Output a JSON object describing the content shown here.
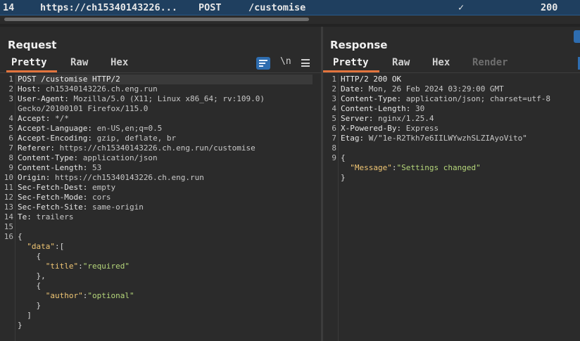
{
  "history_row": {
    "number": "14",
    "host": "https://ch15340143226...",
    "method": "POST",
    "path": "/customise",
    "checkmark": "✓",
    "status": "200"
  },
  "request": {
    "title": "Request",
    "tabs": [
      "Pretty",
      "Raw",
      "Hex"
    ],
    "active_tab": "Pretty",
    "tools": {
      "wrap_icon": "wrap-lines-icon",
      "newline_label": "\\n",
      "menu_icon": "hamburger-menu-icon"
    },
    "lines": [
      {
        "n": "1",
        "parts": [
          {
            "t": "POST /customise HTTP/2",
            "c": "req-line"
          }
        ]
      },
      {
        "n": "2",
        "parts": [
          {
            "t": "Host: ",
            "c": "hdr-name"
          },
          {
            "t": "ch15340143226.ch.eng.run",
            "c": "hdr-val"
          }
        ]
      },
      {
        "n": "3",
        "parts": [
          {
            "t": "User-Agent: ",
            "c": "hdr-name"
          },
          {
            "t": "Mozilla/5.0 (X11; Linux x86_64; rv:109.0)",
            "c": "hdr-val"
          }
        ]
      },
      {
        "n": "",
        "parts": [
          {
            "t": "Gecko/20100101 Firefox/115.0",
            "c": "hdr-val"
          }
        ]
      },
      {
        "n": "4",
        "parts": [
          {
            "t": "Accept: ",
            "c": "hdr-name"
          },
          {
            "t": "*/*",
            "c": "hdr-val"
          }
        ]
      },
      {
        "n": "5",
        "parts": [
          {
            "t": "Accept-Language: ",
            "c": "hdr-name"
          },
          {
            "t": "en-US,en;q=0.5",
            "c": "hdr-val"
          }
        ]
      },
      {
        "n": "6",
        "parts": [
          {
            "t": "Accept-Encoding: ",
            "c": "hdr-name"
          },
          {
            "t": "gzip, deflate, br",
            "c": "hdr-val"
          }
        ]
      },
      {
        "n": "7",
        "parts": [
          {
            "t": "Referer: ",
            "c": "hdr-name"
          },
          {
            "t": "https://ch15340143226.ch.eng.run/customise",
            "c": "hdr-val"
          }
        ]
      },
      {
        "n": "8",
        "parts": [
          {
            "t": "Content-Type: ",
            "c": "hdr-name"
          },
          {
            "t": "application/json",
            "c": "hdr-val"
          }
        ]
      },
      {
        "n": "9",
        "parts": [
          {
            "t": "Content-Length: ",
            "c": "hdr-name"
          },
          {
            "t": "53",
            "c": "hdr-val"
          }
        ]
      },
      {
        "n": "10",
        "parts": [
          {
            "t": "Origin: ",
            "c": "hdr-name"
          },
          {
            "t": "https://ch15340143226.ch.eng.run",
            "c": "hdr-val"
          }
        ]
      },
      {
        "n": "11",
        "parts": [
          {
            "t": "Sec-Fetch-Dest: ",
            "c": "hdr-name"
          },
          {
            "t": "empty",
            "c": "hdr-val"
          }
        ]
      },
      {
        "n": "12",
        "parts": [
          {
            "t": "Sec-Fetch-Mode: ",
            "c": "hdr-name"
          },
          {
            "t": "cors",
            "c": "hdr-val"
          }
        ]
      },
      {
        "n": "13",
        "parts": [
          {
            "t": "Sec-Fetch-Site: ",
            "c": "hdr-name"
          },
          {
            "t": "same-origin",
            "c": "hdr-val"
          }
        ]
      },
      {
        "n": "14",
        "parts": [
          {
            "t": "Te: ",
            "c": "hdr-name"
          },
          {
            "t": "trailers",
            "c": "hdr-val"
          }
        ]
      },
      {
        "n": "15",
        "parts": []
      },
      {
        "n": "16",
        "parts": [
          {
            "t": "{",
            "c": "json-punct"
          }
        ]
      },
      {
        "n": "",
        "parts": [
          {
            "t": "  ",
            "c": "json-punct"
          },
          {
            "t": "\"data\"",
            "c": "json-key"
          },
          {
            "t": ":[",
            "c": "json-punct"
          }
        ]
      },
      {
        "n": "",
        "parts": [
          {
            "t": "    {",
            "c": "json-punct"
          }
        ]
      },
      {
        "n": "",
        "parts": [
          {
            "t": "      ",
            "c": "json-punct"
          },
          {
            "t": "\"title\"",
            "c": "json-key"
          },
          {
            "t": ":",
            "c": "json-punct"
          },
          {
            "t": "\"required\"",
            "c": "json-str"
          }
        ]
      },
      {
        "n": "",
        "parts": [
          {
            "t": "    },",
            "c": "json-punct"
          }
        ]
      },
      {
        "n": "",
        "parts": [
          {
            "t": "    {",
            "c": "json-punct"
          }
        ]
      },
      {
        "n": "",
        "parts": [
          {
            "t": "      ",
            "c": "json-punct"
          },
          {
            "t": "\"author\"",
            "c": "json-key"
          },
          {
            "t": ":",
            "c": "json-punct"
          },
          {
            "t": "\"optional\"",
            "c": "json-str"
          }
        ]
      },
      {
        "n": "",
        "parts": [
          {
            "t": "    }",
            "c": "json-punct"
          }
        ]
      },
      {
        "n": "",
        "parts": [
          {
            "t": "  ]",
            "c": "json-punct"
          }
        ]
      },
      {
        "n": "",
        "parts": [
          {
            "t": "}",
            "c": "json-punct"
          }
        ]
      }
    ]
  },
  "response": {
    "title": "Response",
    "tabs": [
      "Pretty",
      "Raw",
      "Hex",
      "Render"
    ],
    "active_tab": "Pretty",
    "disabled_tab": "Render",
    "lines": [
      {
        "n": "1",
        "parts": [
          {
            "t": "HTTP/2 200 OK",
            "c": "req-line"
          }
        ]
      },
      {
        "n": "2",
        "parts": [
          {
            "t": "Date: ",
            "c": "hdr-name"
          },
          {
            "t": "Mon, 26 Feb 2024 03:29:00 GMT",
            "c": "hdr-val"
          }
        ]
      },
      {
        "n": "3",
        "parts": [
          {
            "t": "Content-Type: ",
            "c": "hdr-name"
          },
          {
            "t": "application/json; charset=utf-8",
            "c": "hdr-val"
          }
        ]
      },
      {
        "n": "4",
        "parts": [
          {
            "t": "Content-Length: ",
            "c": "hdr-name"
          },
          {
            "t": "30",
            "c": "hdr-val"
          }
        ]
      },
      {
        "n": "5",
        "parts": [
          {
            "t": "Server: ",
            "c": "hdr-name"
          },
          {
            "t": "nginx/1.25.4",
            "c": "hdr-val"
          }
        ]
      },
      {
        "n": "6",
        "parts": [
          {
            "t": "X-Powered-By: ",
            "c": "hdr-name"
          },
          {
            "t": "Express",
            "c": "hdr-val"
          }
        ]
      },
      {
        "n": "7",
        "parts": [
          {
            "t": "Etag: ",
            "c": "hdr-name"
          },
          {
            "t": "W/\"1e-R2Tkh7e6IILWYwzhSLZIAyoVito\"",
            "c": "hdr-val"
          }
        ]
      },
      {
        "n": "8",
        "parts": []
      },
      {
        "n": "9",
        "parts": [
          {
            "t": "{",
            "c": "json-punct"
          }
        ]
      },
      {
        "n": "",
        "parts": [
          {
            "t": "  ",
            "c": "json-punct"
          },
          {
            "t": "\"Message\"",
            "c": "json-key"
          },
          {
            "t": ":",
            "c": "json-punct"
          },
          {
            "t": "\"Settings changed\"",
            "c": "json-str"
          }
        ]
      },
      {
        "n": "",
        "parts": [
          {
            "t": "}",
            "c": "json-punct"
          }
        ]
      }
    ]
  },
  "colors": {
    "accent": "#e3743d",
    "selected_row": "#1f3f5f",
    "button_blue": "#2e6db0",
    "background": "#2b2b2b"
  }
}
